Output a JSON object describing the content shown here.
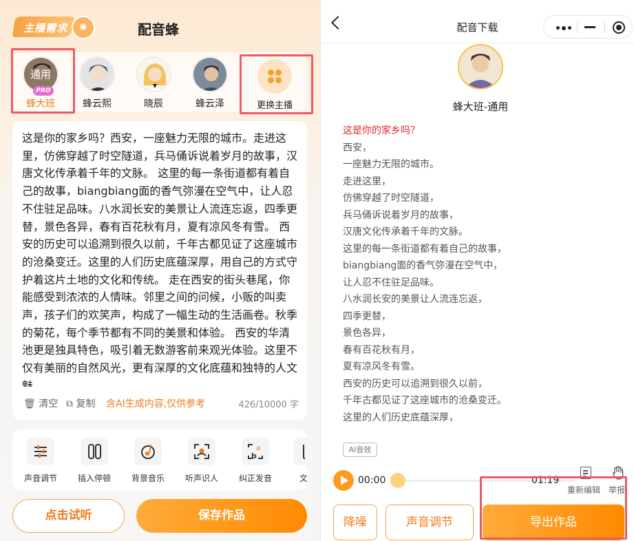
{
  "left": {
    "logo_text": "主播需求",
    "app_title": "配音蜂",
    "anchors": [
      {
        "name": "蜂大班",
        "badge": "通用",
        "pro": "PRO",
        "selected": true
      },
      {
        "name": "蜂云熙"
      },
      {
        "name": "晓辰"
      },
      {
        "name": "蜂云泽"
      }
    ],
    "swap_label": "更换主播",
    "script_text": "这是你的家乡吗？西安，一座魅力无限的城市。走进这里，仿佛穿越了时空隧道，兵马俑诉说着岁月的故事，汉唐文化传承着千年的文脉。 这里的每一条街道都有着自己的故事，biangbiang面的香气弥漫在空气中，让人忍不住驻足品味。八水润长安的美景让人流连忘返，四季更替，景色各异，春有百花秋有月，夏有凉风冬有雪。 西安的历史可以追溯到很久以前，千年古都见证了这座城市的沧桑变迁。这里的人们历史底蕴深厚，用自己的方式守护着这片土地的文化和传统。 走在西安的街头巷尾，你能感受到浓浓的人情味。邻里之间的问候，小贩的叫卖声，孩子们的欢笑声，构成了一幅生动的生活画卷。秋季的菊花，每个季节都有不同的美景和体验。 西安的华清池更是独具特色，吸引着无数游客前来观光体验。这里不仅有美丽的自然风光，更有深厚的文化底蕴和独特的人文魅",
    "clear_label": "清空",
    "copy_label": "复制",
    "ai_notice": "含AI生成内容,仅供参考",
    "char_count": "426/10000 字",
    "tools": [
      {
        "label": "声音调节",
        "icon": "sliders-icon"
      },
      {
        "label": "插入停顿",
        "icon": "pause-icon"
      },
      {
        "label": "背景音乐",
        "icon": "music-icon"
      },
      {
        "label": "听声识人",
        "icon": "scan-voice-icon"
      },
      {
        "label": "纠正发音",
        "icon": "pronunciation-icon"
      },
      {
        "label": "文案",
        "icon": "document-icon"
      }
    ],
    "try_label": "点击试听",
    "save_label": "保存作品"
  },
  "right": {
    "title": "配音下载",
    "voice_name": "蜂大班-通用",
    "lines": [
      "这是你的家乡吗？",
      "西安，",
      "一座魅力无限的城市。",
      "走进这里，",
      "仿佛穿越了时空隧道，",
      "兵马俑诉说着岁月的故事，",
      "汉唐文化传承着千年的文脉。",
      "这里的每一条街道都有着自己的故事，",
      "biangbiang面的香气弥漫在空气中，",
      "让人忍不住驻足品味。",
      "八水润长安的美景让人流连忘返，",
      "四季更替，",
      "景色各异，",
      "春有百花秋有月，",
      "夏有凉风冬有雪。",
      "西安的历史可以追溯到很久以前，",
      "千年古都见证了这座城市的沧桑变迁。",
      "这里的人们历史底蕴深厚，"
    ],
    "ai_tag": "AI音效",
    "time_current": "00:00",
    "time_total": "01:19",
    "reedit_label": "重新编辑",
    "report_label": "举报",
    "noise_label": "降噪",
    "adjust_label": "声音调节",
    "export_label": "导出作品",
    "highlight_color": "#e0262b",
    "accent": "#ff8a00"
  }
}
